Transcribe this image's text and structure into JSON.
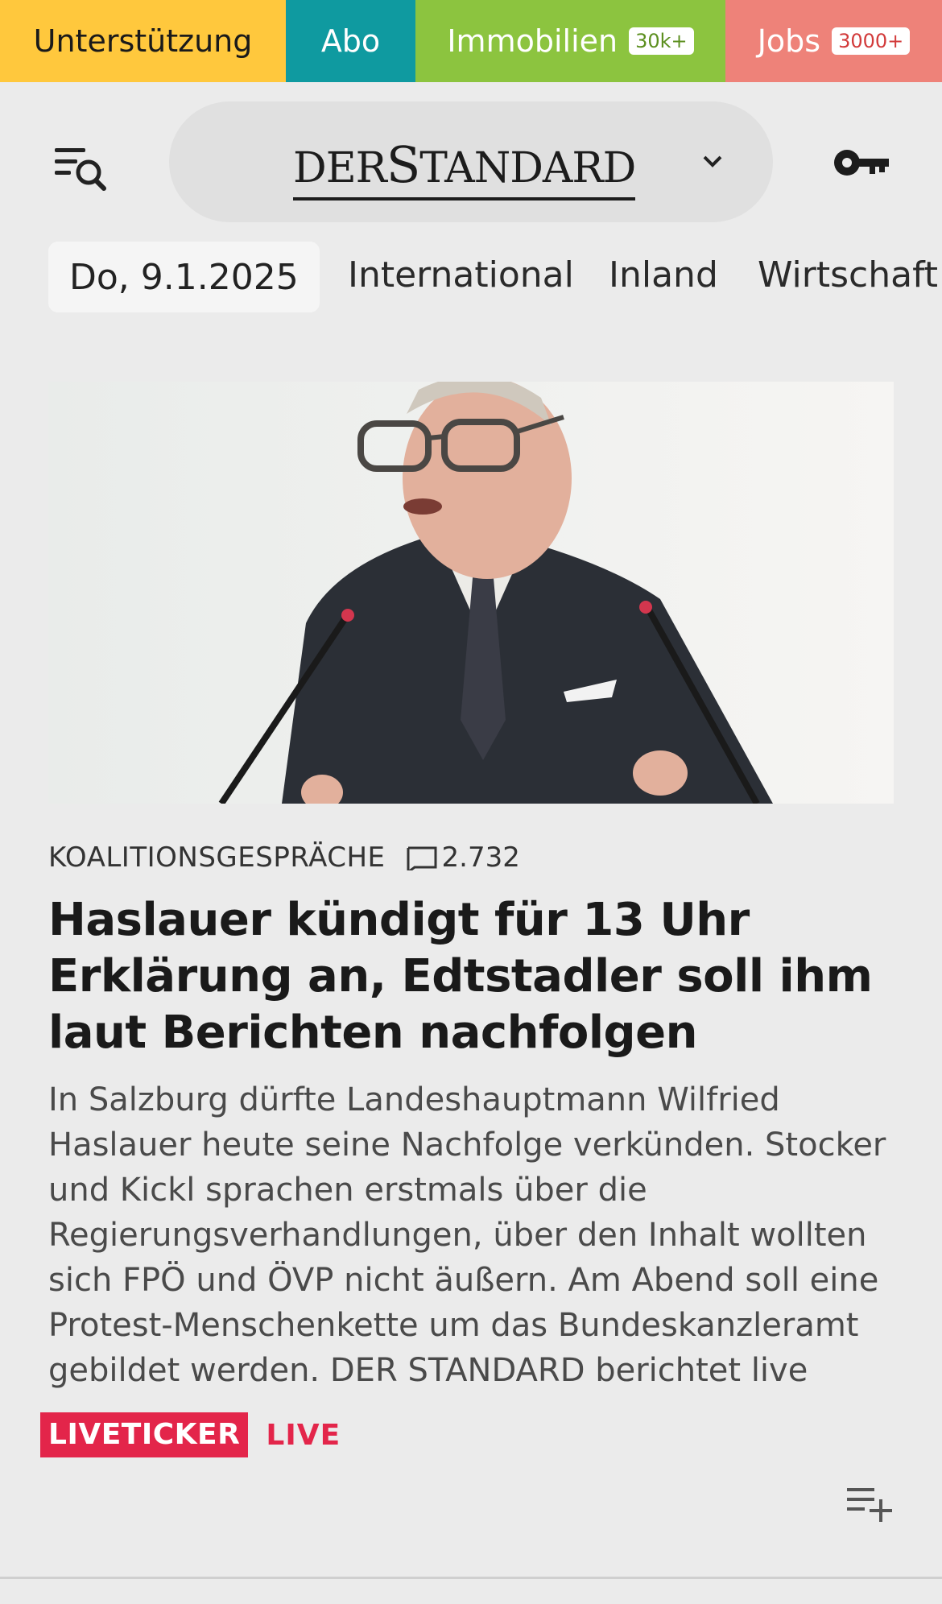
{
  "topstrip": [
    {
      "label": "Unterstützung",
      "badge": "",
      "bg": "#ffc83d",
      "color": "#1a1a1a",
      "badge_color": ""
    },
    {
      "label": "Abo",
      "badge": "",
      "bg": "#0f9aa0",
      "color": "#ffffff",
      "badge_color": ""
    },
    {
      "label": "Immobilien",
      "badge": "30k+",
      "bg": "#8cc43f",
      "color": "#ffffff",
      "badge_color": "#5c8f1f"
    },
    {
      "label": "Jobs",
      "badge": "3000+",
      "bg": "#ee8279",
      "color": "#ffffff",
      "badge_color": "#d23a3a"
    }
  ],
  "header": {
    "logo_prefix": "DER",
    "logo_s": "S",
    "logo_rest": "TANDARD",
    "menu_icon": "menu-search-icon",
    "login_icon": "key-icon"
  },
  "nav": {
    "date": "Do, 9.1.2025",
    "items": [
      "International",
      "Inland",
      "Wirtschaft"
    ]
  },
  "teaser": {
    "kicker": "KOALITIONSGESPRÄCHE",
    "comment_count": "2.732",
    "headline": "Haslauer kündigt für 13 Uhr Erklärung an, Edtstadler soll ihm laut Berichten nachfolgen",
    "lead": "In Salzburg dürfte Landeshauptmann Wilfried Haslauer heute seine Nachfolge verkünden. Stocker und Kickl sprachen erstmals über die Regierungsver­handlungen, über den Inhalt wollten sich FPÖ und ÖVP nicht äußern. Am Abend soll eine Protest-Men­schenkette um das Bundeskanzleramt gebildet werden. DER STANDARD berichtet live",
    "badge": "LIVETICKER",
    "live": "LIVE"
  },
  "colors": {
    "background": "#ebebeb",
    "live_red": "#e3254a",
    "logo_pill": "#e0e0e0"
  }
}
